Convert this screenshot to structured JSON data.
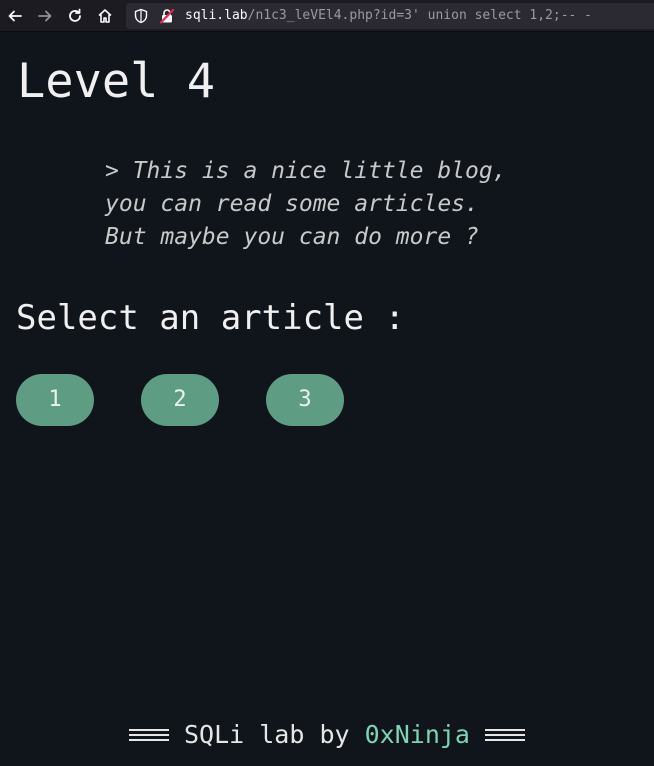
{
  "browser": {
    "url_host": "sqli.lab",
    "url_path": "/n1c3_leVEl4.php?id=3' union select 1,2;-- -"
  },
  "page": {
    "title": "Level 4",
    "intro": "> This is a nice little blog,\nyou can read some articles.\nBut maybe you can do more ?",
    "section_heading": "Select an article :"
  },
  "articles": [
    {
      "label": "1"
    },
    {
      "label": "2"
    },
    {
      "label": "3"
    }
  ],
  "footer": {
    "prefix": "SQLi lab by ",
    "author": "0xNinja"
  },
  "colors": {
    "background": "#10151c",
    "button": "#5e9c84",
    "author_accent": "#7ed3b2"
  }
}
